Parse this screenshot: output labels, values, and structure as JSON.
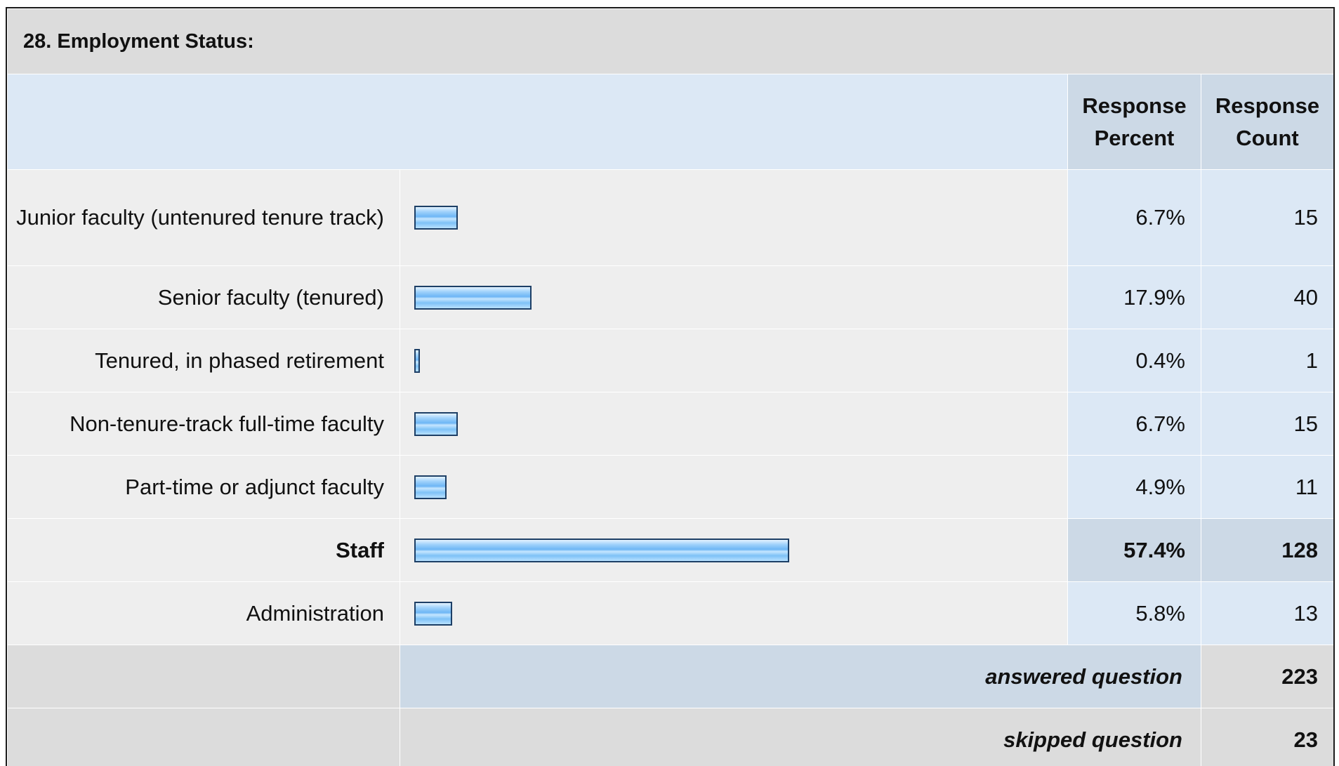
{
  "title": "28. Employment Status:",
  "columns": {
    "percent": "Response Percent",
    "count": "Response Count"
  },
  "chart_data": {
    "type": "bar",
    "title": "28. Employment Status:",
    "orientation": "horizontal",
    "categories": [
      "Junior faculty (untenured tenure track)",
      "Senior faculty (tenured)",
      "Tenured, in phased retirement",
      "Non-tenure-track full-time faculty",
      "Part-time or adjunct faculty",
      "Staff",
      "Administration"
    ],
    "percent_labels": [
      "6.7%",
      "17.9%",
      "0.4%",
      "6.7%",
      "4.9%",
      "57.4%",
      "5.8%"
    ],
    "values": [
      6.7,
      17.9,
      0.4,
      6.7,
      4.9,
      57.4,
      5.8
    ],
    "counts": [
      15,
      40,
      1,
      15,
      11,
      128,
      13
    ],
    "highlight_index": 5,
    "xlim": [
      0,
      100
    ]
  },
  "summary": {
    "answered_label": "answered question",
    "answered_value": "223",
    "skipped_label": "skipped question",
    "skipped_value": "23"
  }
}
